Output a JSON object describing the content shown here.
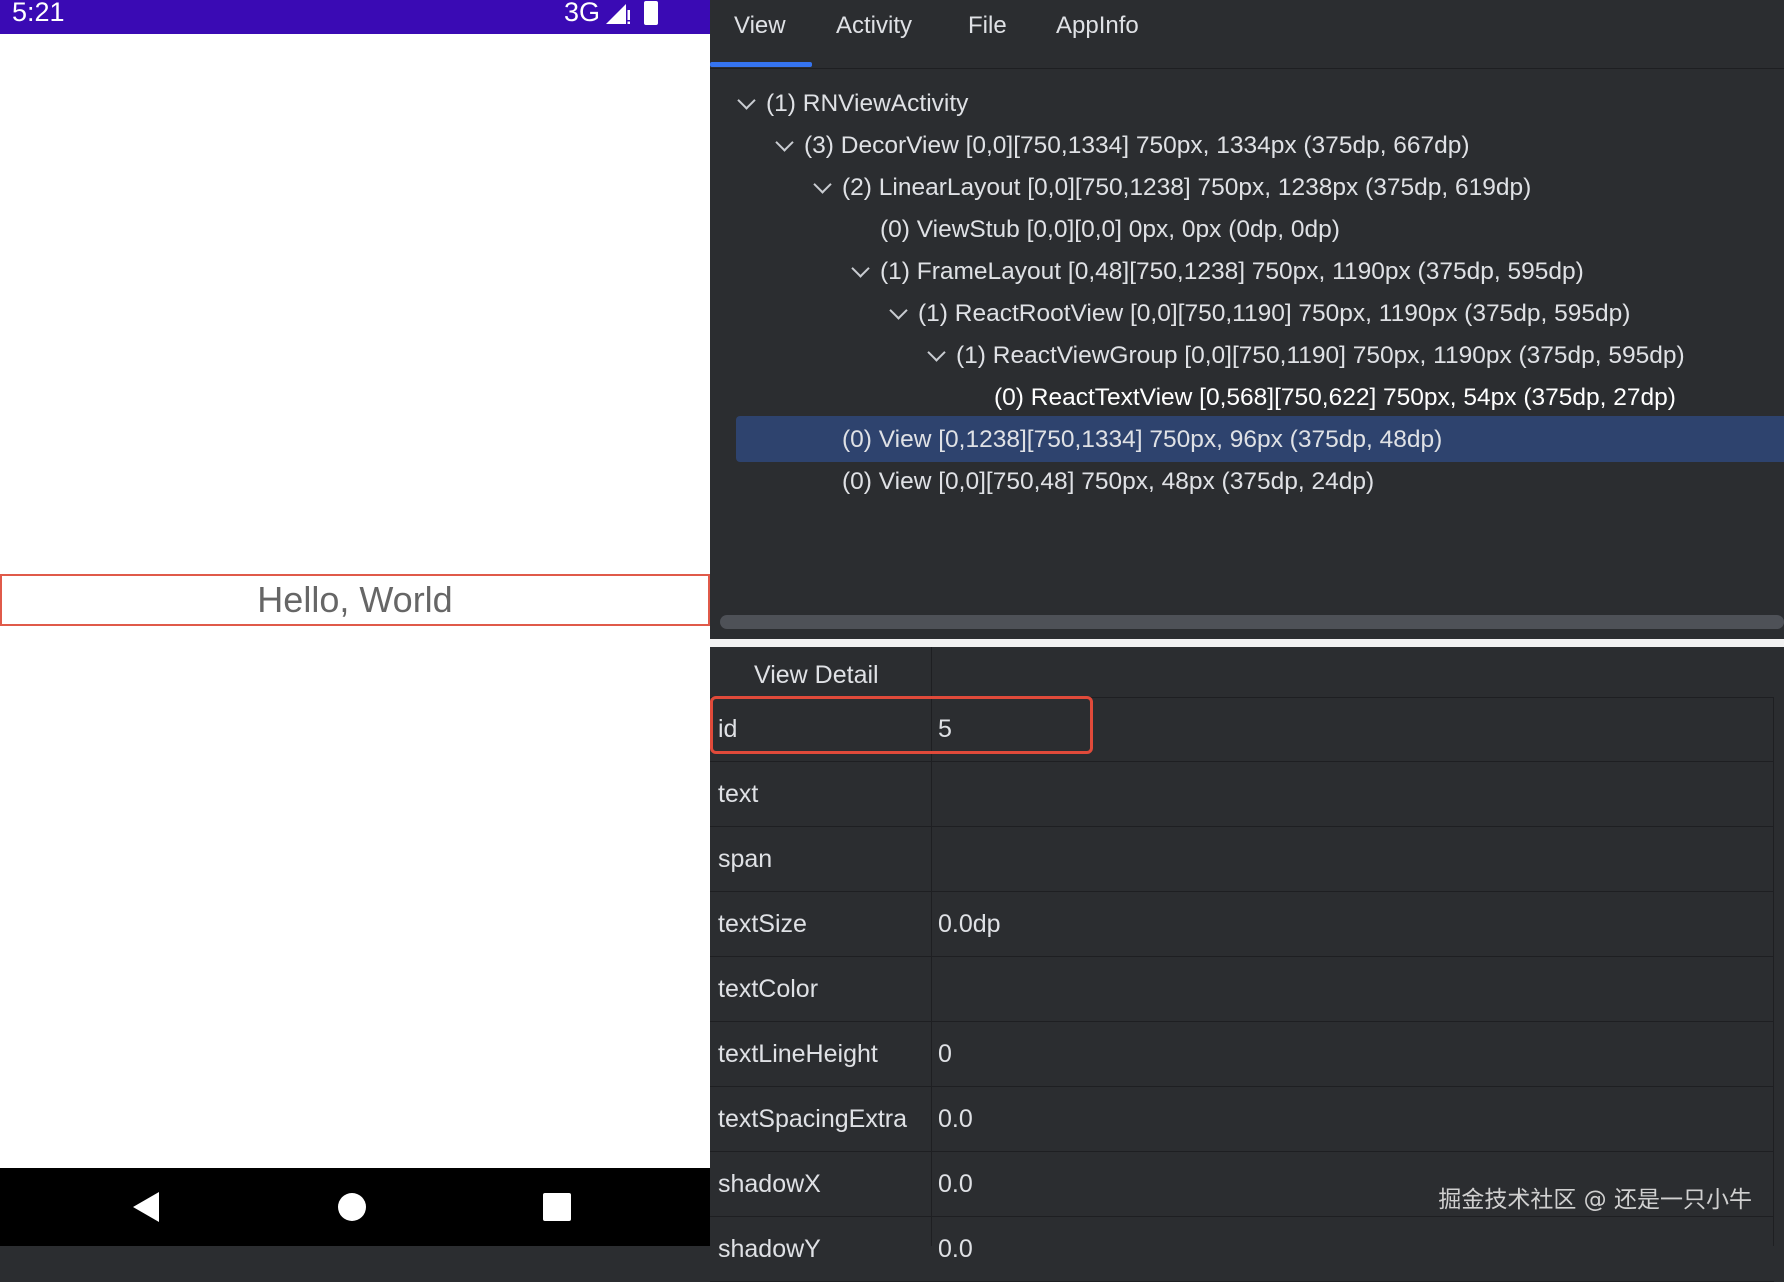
{
  "status_bar": {
    "time": "5:21",
    "network": "3G",
    "background": "#3a0ab4"
  },
  "phone": {
    "hello_text": "Hello, World",
    "highlight_color": "#e05a4a"
  },
  "tabs": [
    {
      "label": "View",
      "active": true
    },
    {
      "label": "Activity",
      "active": false
    },
    {
      "label": "File",
      "active": false
    },
    {
      "label": "AppInfo",
      "active": false
    }
  ],
  "tree": [
    {
      "label": "(1) RNViewActivity",
      "expanded": true
    },
    {
      "label": "(3) DecorView [0,0][750,1334]  750px, 1334px (375dp, 667dp)",
      "expanded": true
    },
    {
      "label": "(2) LinearLayout [0,0][750,1238]  750px, 1238px (375dp, 619dp)",
      "expanded": true
    },
    {
      "label": "(0) ViewStub [0,0][0,0]  0px, 0px (0dp, 0dp)",
      "expanded": false
    },
    {
      "label": "(1) FrameLayout [0,48][750,1238]  750px, 1190px (375dp, 595dp)",
      "expanded": true
    },
    {
      "label": "(1) ReactRootView [0,0][750,1190]  750px, 1190px (375dp, 595dp)",
      "expanded": true
    },
    {
      "label": "(1) ReactViewGroup [0,0][750,1190]  750px, 1190px (375dp, 595dp)",
      "expanded": true
    },
    {
      "label": "(0) ReactTextView [0,568][750,622]  750px, 54px (375dp, 27dp)",
      "expanded": false,
      "selected": true
    },
    {
      "label": "(0) View [0,1238][750,1334]  750px, 96px (375dp, 48dp)",
      "expanded": false
    },
    {
      "label": "(0) View [0,0][750,48]  750px, 48px (375dp, 24dp)",
      "expanded": false
    }
  ],
  "detail": {
    "title": "View Detail",
    "rows": [
      {
        "key": "id",
        "value": "5"
      },
      {
        "key": "text",
        "value": ""
      },
      {
        "key": "span",
        "value": ""
      },
      {
        "key": "textSize",
        "value": "0.0dp"
      },
      {
        "key": "textColor",
        "value": ""
      },
      {
        "key": "textLineHeight",
        "value": "0"
      },
      {
        "key": "textSpacingExtra",
        "value": "0.0"
      },
      {
        "key": "shadowX",
        "value": "0.0"
      },
      {
        "key": "shadowY",
        "value": "0.0"
      }
    ]
  },
  "watermark": "掘金技术社区 @ 还是一只小牛",
  "colors": {
    "accent": "#3574f0",
    "selection": "#2e436e",
    "panel": "#2b2d30",
    "highlight_box": "#e04a3a"
  }
}
